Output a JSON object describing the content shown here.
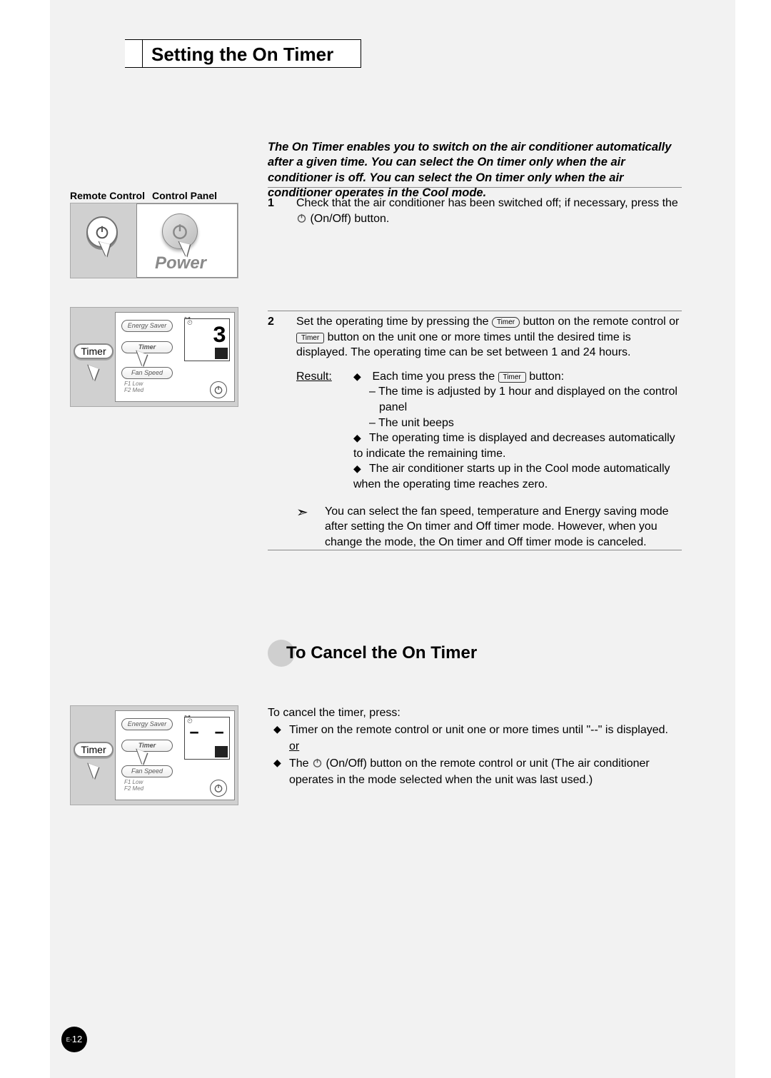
{
  "title": "Setting the On Timer",
  "intro": "The On Timer enables you to switch on the air conditioner automatically after a given time. You can select the On timer only when the air conditioner is off. You can select the On timer only when the air conditioner operates in the Cool mode.",
  "col_labels": {
    "remote": "Remote Control",
    "panel": "Control Panel"
  },
  "illus": {
    "power_label": "Power",
    "timer_btn": "Timer",
    "panel_buttons": {
      "energy": "Energy Saver",
      "timer": "Timer",
      "fan": "Fan Speed"
    },
    "panel_sub": "F1 Low\nF2 Med",
    "lcd_digit_1": "3",
    "lcd_digit_2": "– –",
    "pill_timer": "Timer"
  },
  "step1": {
    "num": "1",
    "text_a": "Check that the air conditioner has been switched off; if necessary, press the ",
    "text_b": " (On/Off) button."
  },
  "step2": {
    "num": "2",
    "line1_a": "Set the operating time by pressing the ",
    "line1_b": " button on the remote control or ",
    "line1_c": " button on the unit one or more times until the desired time is displayed. The operating time can be set between 1 and 24 hours.",
    "result_label": "Result:",
    "r1_a": "Each time you press the ",
    "r1_b": " button:",
    "r1_sub1": "The time is adjusted by 1 hour and displayed on the control panel",
    "r1_sub2": "The unit beeps",
    "r2": "The operating time is displayed and decreases automatically to indicate the remaining time.",
    "r3": "The air conditioner starts up in the Cool mode automatically when the operating time reaches zero.",
    "note": "You can select the fan speed, temperature and Energy saving mode after setting the On timer and Off timer mode. However, when you change the mode, the On timer and Off timer mode is canceled."
  },
  "sub_heading": "To Cancel the On Timer",
  "cancel": {
    "intro": "To cancel the timer, press:",
    "item1": "Timer on the remote control or unit one or more times until \"--\" is displayed.",
    "or": "or",
    "item2_a": "The ",
    "item2_b": " (On/Off) button on  the remote control or unit (The air conditioner operates in the mode selected when the unit was last used.)"
  },
  "page_num": {
    "prefix": "E-",
    "num": "12"
  }
}
